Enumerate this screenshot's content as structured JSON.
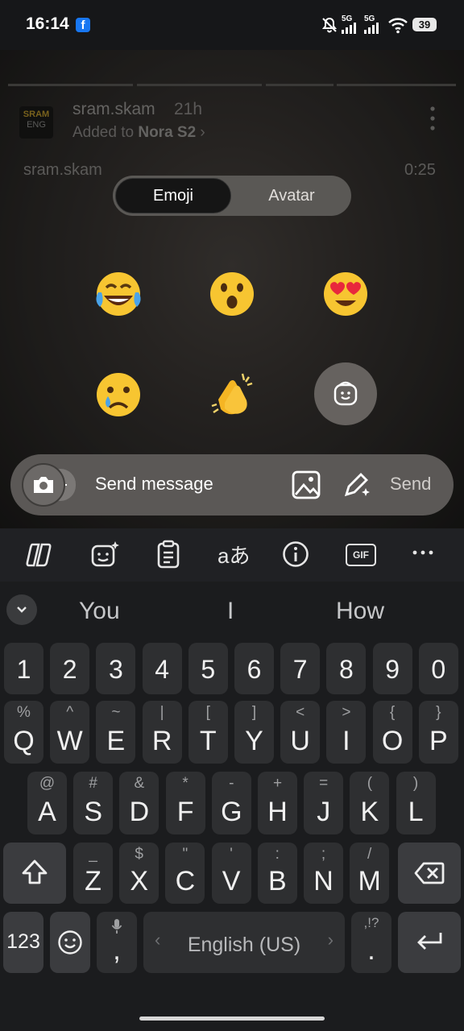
{
  "status_bar": {
    "time": "16:14",
    "battery": "39",
    "network_1": "5G",
    "network_2": "5G"
  },
  "story": {
    "username": "sram.skam",
    "time_ago": "21h",
    "added_prefix": "Added to ",
    "collection": "Nora S2",
    "audio_user": "sram.skam",
    "audio_time": "0:25",
    "logo_line1": "SRAM",
    "logo_line2": "ENG"
  },
  "reaction_tabs": {
    "emoji": "Emoji",
    "avatar": "Avatar",
    "selected": "Emoji"
  },
  "reactions": [
    "face-with-tears-of-joy",
    "astonished-face",
    "heart-eyes-face",
    "crying-face",
    "clapping-hands",
    "avatar-sticker"
  ],
  "message_bar": {
    "placeholder": "Send message",
    "send_label": "Send"
  },
  "keyboard": {
    "toolbar": [
      "copilot-icon",
      "ai-sticker-icon",
      "clipboard-icon",
      "translate-icon",
      "info-icon",
      "gif-icon",
      "more-icon"
    ],
    "suggestions": [
      "You",
      "I",
      "How"
    ],
    "row_numbers": [
      "1",
      "2",
      "3",
      "4",
      "5",
      "6",
      "7",
      "8",
      "9",
      "0"
    ],
    "row_q": [
      [
        "Q",
        "%"
      ],
      [
        "W",
        "^"
      ],
      [
        "E",
        "~"
      ],
      [
        "R",
        "|"
      ],
      [
        "T",
        "["
      ],
      [
        "Y",
        "]"
      ],
      [
        "U",
        "<"
      ],
      [
        "I",
        ">"
      ],
      [
        "O",
        "{"
      ],
      [
        "P",
        "}"
      ]
    ],
    "row_a": [
      [
        "A",
        "@"
      ],
      [
        "S",
        "#"
      ],
      [
        "D",
        "&"
      ],
      [
        "F",
        "*"
      ],
      [
        "G",
        "-"
      ],
      [
        "H",
        "+"
      ],
      [
        "J",
        "="
      ],
      [
        "K",
        "("
      ],
      [
        "L",
        ")"
      ]
    ],
    "row_z": [
      [
        "Z",
        "_"
      ],
      [
        "X",
        "$"
      ],
      [
        "C",
        "\""
      ],
      [
        "V",
        "'"
      ],
      [
        "B",
        ":"
      ],
      [
        "N",
        ";"
      ],
      [
        "M",
        "/"
      ]
    ],
    "key_123": "123",
    "comma": ",",
    "space_label": "English (US)",
    "period": ".",
    "period_alt": ",!?"
  },
  "colors": {
    "accent_blue": "#1877f2",
    "keyboard_bg": "#1b1c1e",
    "key_bg": "#2e2f31"
  }
}
